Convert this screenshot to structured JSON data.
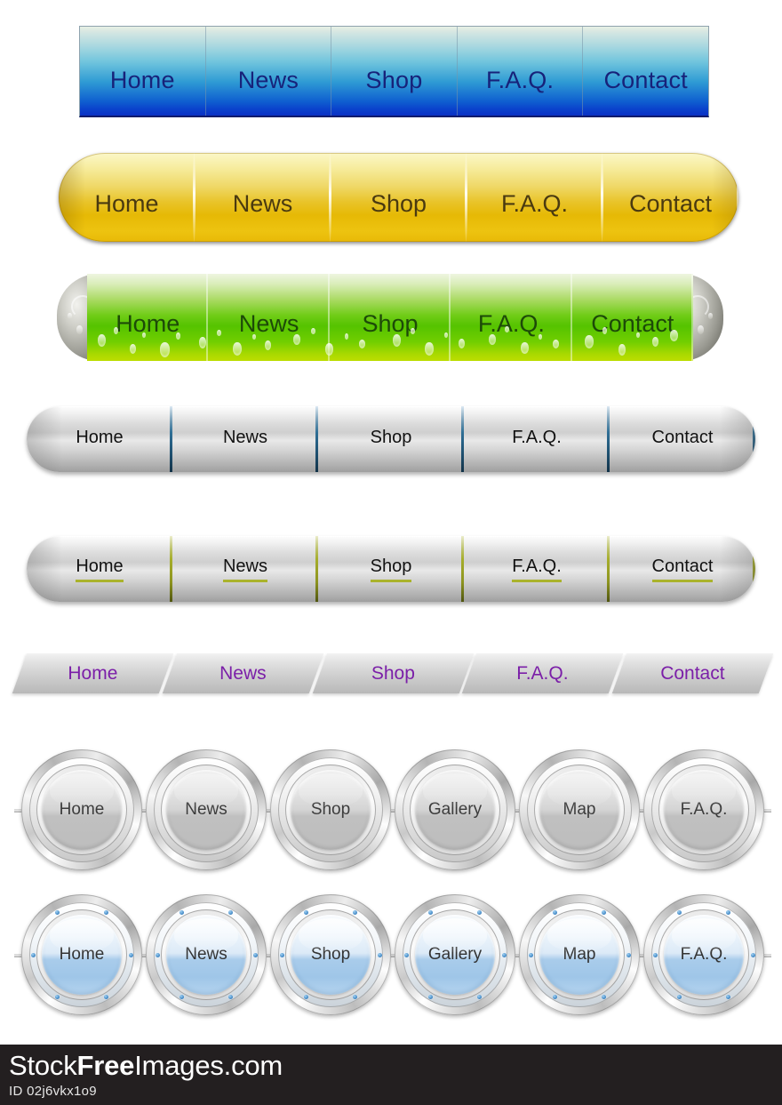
{
  "navbars": [
    {
      "id": "blue-rectangular-bar",
      "style": "blue-gradient-rectangular",
      "text_color": "#17227a",
      "items": [
        "Home",
        "News",
        "Shop",
        "F.A.Q.",
        "Contact"
      ]
    },
    {
      "id": "yellow-tube-bar",
      "style": "gold-cylinder-rounded",
      "text_color": "#4a3a10",
      "items": [
        "Home",
        "News",
        "Shop",
        "F.A.Q.",
        "Contact"
      ]
    },
    {
      "id": "green-tube-bar",
      "style": "green-cylinder-metal-caps-bubbles",
      "text_color": "#1d4a08",
      "items": [
        "Home",
        "News",
        "Shop",
        "F.A.Q.",
        "Contact"
      ]
    },
    {
      "id": "gray-pill-bar-blue-dividers",
      "style": "silver-pill-blue-separators",
      "text_color": "#111111",
      "divider_color": "#2f6f96",
      "items": [
        "Home",
        "News",
        "Shop",
        "F.A.Q.",
        "Contact"
      ]
    },
    {
      "id": "gray-pill-bar-olive-underline",
      "style": "silver-pill-olive-separators-underlined",
      "text_color": "#111111",
      "divider_color": "#a6ae2b",
      "underline_color": "#aab32c",
      "items": [
        "Home",
        "News",
        "Shop",
        "F.A.Q.",
        "Contact"
      ]
    },
    {
      "id": "purple-skewed-bar",
      "style": "gray-parallelogram-purple-text",
      "text_color": "#7b1fa8",
      "items": [
        "Home",
        "News",
        "Shop",
        "F.A.Q.",
        "Contact"
      ]
    }
  ],
  "circle_rows": [
    {
      "id": "gray-circle-buttons",
      "style": "silver-metallic-round",
      "text_color": "#3c3c3c",
      "items": [
        "Home",
        "News",
        "Shop",
        "Gallery",
        "Map",
        "F.A.Q."
      ]
    },
    {
      "id": "blue-circle-buttons",
      "style": "blue-glossy-porthole-round-with-rivets",
      "text_color": "#333333",
      "accent_color": "#3f86c4",
      "items": [
        "Home",
        "News",
        "Shop",
        "Gallery",
        "Map",
        "F.A.Q."
      ]
    }
  ],
  "footer": {
    "brand_prefix": "Stock",
    "brand_bold": "Free",
    "brand_suffix": "Images.com",
    "id_label": "ID 02j6vkx1o9",
    "background": "#231f20",
    "text_color": "#ffffff"
  }
}
